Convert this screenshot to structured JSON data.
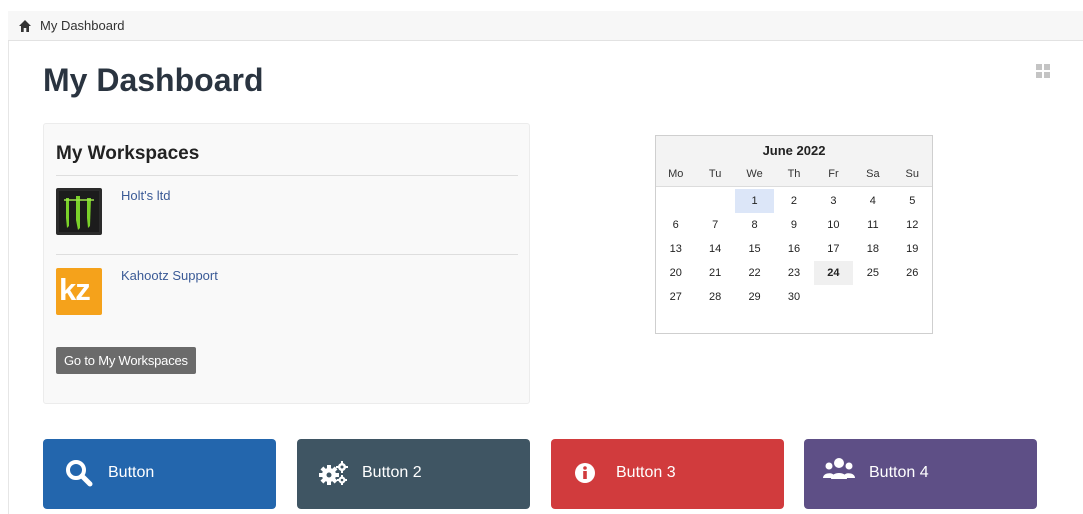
{
  "breadcrumb": {
    "home_label": "My Dashboard"
  },
  "page": {
    "title": "My Dashboard"
  },
  "workspaces": {
    "title": "My Workspaces",
    "items": [
      {
        "name": "Holt's ltd",
        "logo": "monster-logo"
      },
      {
        "name": "Kahootz Support",
        "logo": "kz-logo",
        "logo_text": "kz"
      }
    ],
    "go_button": "Go to My Workspaces"
  },
  "calendar": {
    "month": "June 2022",
    "weekdays": [
      "Mo",
      "Tu",
      "We",
      "Th",
      "Fr",
      "Sa",
      "Su"
    ],
    "leading_blanks": 2,
    "days": [
      "1",
      "2",
      "3",
      "4",
      "5",
      "6",
      "7",
      "8",
      "9",
      "10",
      "11",
      "12",
      "13",
      "14",
      "15",
      "16",
      "17",
      "18",
      "19",
      "20",
      "21",
      "22",
      "23",
      "24",
      "25",
      "26",
      "27",
      "28",
      "29",
      "30"
    ],
    "selected": "1",
    "today": "24"
  },
  "buttons": [
    {
      "label": "Button",
      "icon": "search-icon",
      "color": "#2366ad"
    },
    {
      "label": "Button 2",
      "icon": "gears-icon",
      "color": "#3f5563"
    },
    {
      "label": "Button 3",
      "icon": "info-icon",
      "color": "#d13b3d"
    },
    {
      "label": "Button 4",
      "icon": "users-icon",
      "color": "#5e4f86"
    }
  ]
}
